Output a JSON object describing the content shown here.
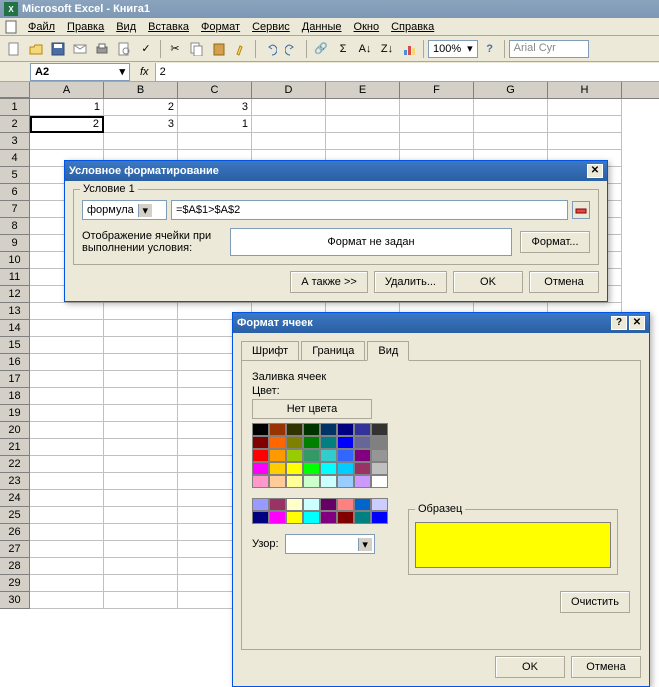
{
  "title": "Microsoft Excel - Книга1",
  "menubar": [
    "Файл",
    "Правка",
    "Вид",
    "Вставка",
    "Формат",
    "Сервис",
    "Данные",
    "Окно",
    "Справка"
  ],
  "zoom": "100%",
  "font": "Arial Cyr",
  "name_box": "A2",
  "fx": "fx",
  "formula": "2",
  "columns": [
    "A",
    "B",
    "C",
    "D",
    "E",
    "F",
    "G",
    "H"
  ],
  "rows": [
    1,
    2,
    3,
    4,
    5,
    6,
    7,
    8,
    9,
    10,
    11,
    12,
    13,
    14,
    15,
    16,
    17,
    18,
    19,
    20,
    21,
    22,
    23,
    24,
    25,
    26,
    27,
    28,
    29,
    30
  ],
  "cells": {
    "r1": {
      "A": "1",
      "B": "2",
      "C": "3"
    },
    "r2": {
      "A": "2",
      "B": "3",
      "C": "1"
    }
  },
  "cond_dialog": {
    "title": "Условное форматирование",
    "group": "Условие 1",
    "type": "формула",
    "formula": "=$A$1>$A$2",
    "desc1": "Отображение ячейки при",
    "desc2": "выполнении условия:",
    "preview": "Формат не задан",
    "format_btn": "Формат...",
    "also_btn": "А также >>",
    "delete_btn": "Удалить...",
    "ok": "OK",
    "cancel": "Отмена"
  },
  "format_dialog": {
    "title": "Формат ячеек",
    "tabs": [
      "Шрифт",
      "Граница",
      "Вид"
    ],
    "section": "Заливка ячеек",
    "color_label": "Цвет:",
    "no_color": "Нет цвета",
    "pattern_label": "Узор:",
    "sample_label": "Образец",
    "clear_btn": "Очистить",
    "ok": "OK",
    "cancel": "Отмена",
    "palette1": [
      "#000000",
      "#993300",
      "#333300",
      "#003300",
      "#003366",
      "#000080",
      "#333399",
      "#333333",
      "#800000",
      "#ff6600",
      "#808000",
      "#008000",
      "#008080",
      "#0000ff",
      "#666699",
      "#808080",
      "#ff0000",
      "#ff9900",
      "#99cc00",
      "#339966",
      "#33cccc",
      "#3366ff",
      "#800080",
      "#969696",
      "#ff00ff",
      "#ffcc00",
      "#ffff00",
      "#00ff00",
      "#00ffff",
      "#00ccff",
      "#993366",
      "#c0c0c0",
      "#ff99cc",
      "#ffcc99",
      "#ffff99",
      "#ccffcc",
      "#ccffff",
      "#99ccff",
      "#cc99ff",
      "#ffffff"
    ],
    "palette2": [
      "#9999ff",
      "#993366",
      "#ffffcc",
      "#ccffff",
      "#660066",
      "#ff8080",
      "#0066cc",
      "#ccccff",
      "#000080",
      "#ff00ff",
      "#ffff00",
      "#00ffff",
      "#800080",
      "#800000",
      "#008080",
      "#0000ff"
    ]
  }
}
